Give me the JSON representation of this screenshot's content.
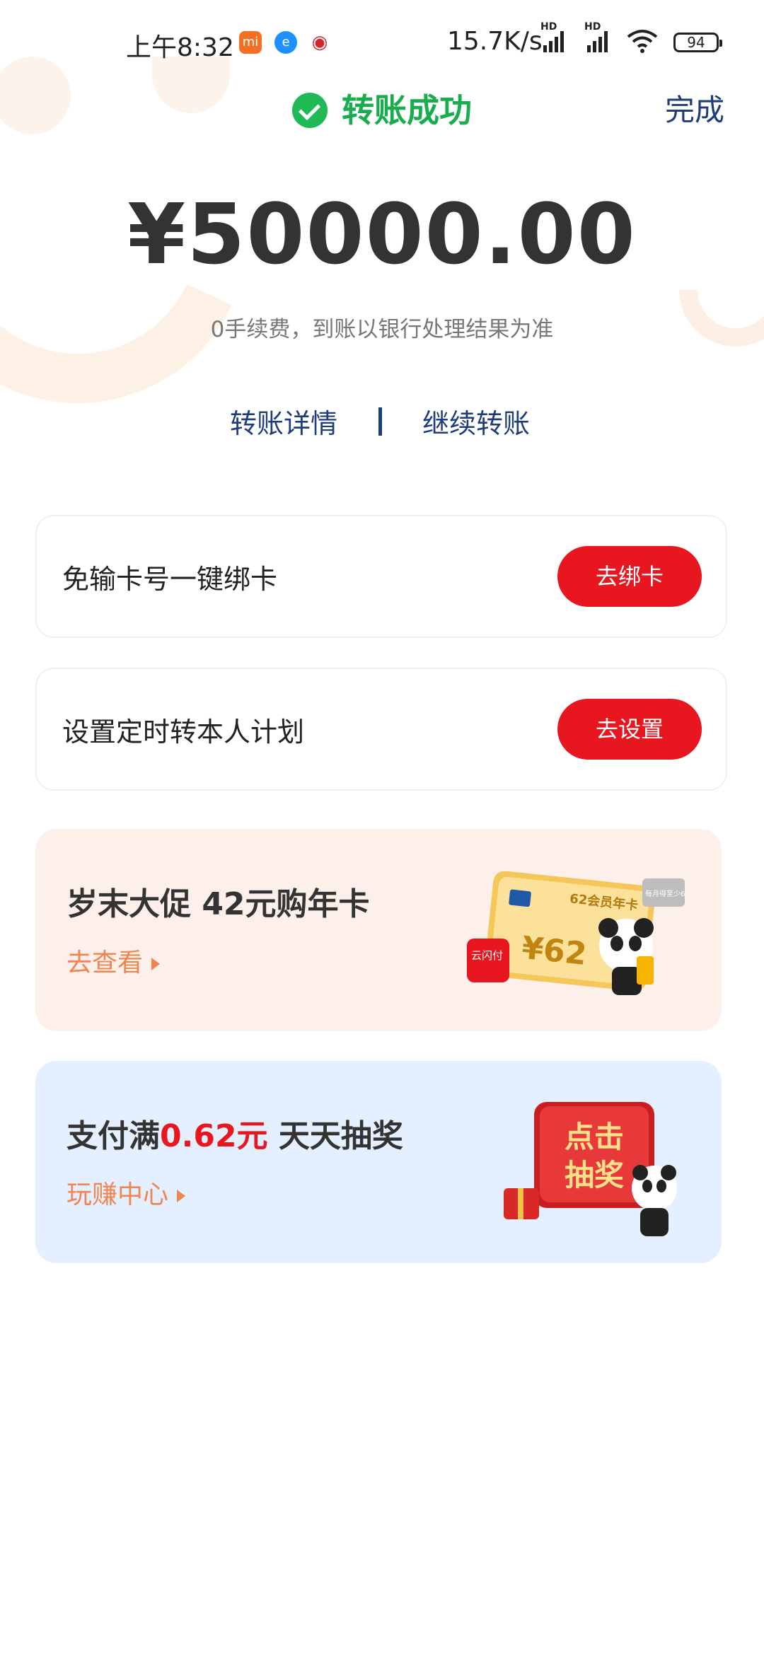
{
  "status_bar": {
    "time": "上午8:32",
    "network_speed": "15.7K/s",
    "hd1": "HD",
    "hd2": "HD",
    "battery": "94"
  },
  "header": {
    "title": "转账成功",
    "done_label": "完成"
  },
  "transfer": {
    "amount": "¥50000.00",
    "fee_note": "0手续费，到账以银行处理结果为准"
  },
  "links": {
    "detail": "转账详情",
    "continue": "继续转账"
  },
  "cards": [
    {
      "text": "免输卡号一键绑卡",
      "button": "去绑卡"
    },
    {
      "text": "设置定时转本人计划",
      "button": "去设置"
    }
  ],
  "promos": [
    {
      "title": "岁末大促 42元购年卡",
      "link": "去查看",
      "art": {
        "card_label": "62会员年卡",
        "card_amount": "¥62",
        "badge": "每月得至少6元",
        "brand": "云闪付"
      }
    },
    {
      "title_prefix": "支付满",
      "title_highlight": "0.62元",
      "title_suffix": " 天天抽奖",
      "link": "玩赚中心",
      "art": {
        "button_line1": "点击",
        "button_line2": "抽奖"
      }
    }
  ],
  "colors": {
    "success_green": "#1aad4e",
    "primary_red": "#e8171f",
    "link_blue": "#1e3d7a",
    "promo_orange": "#f08550"
  }
}
